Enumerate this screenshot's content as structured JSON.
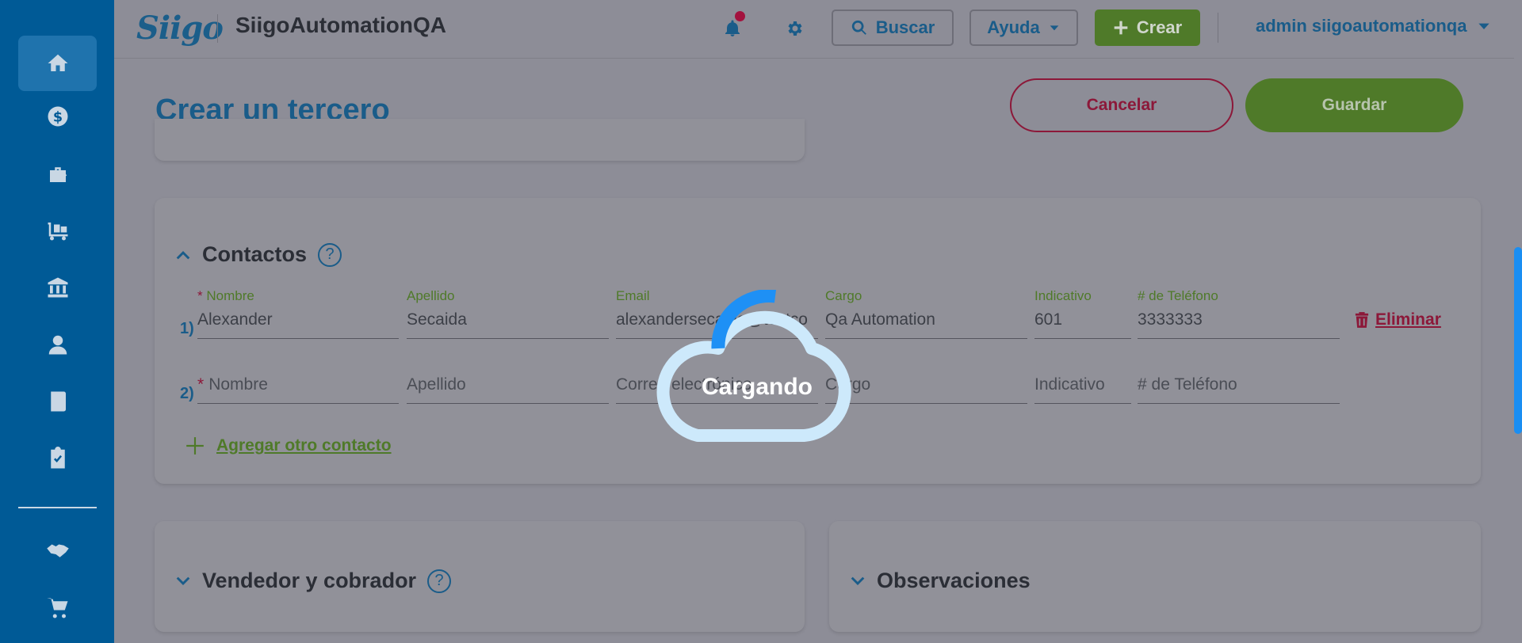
{
  "sidebar": {
    "items": [
      {
        "name": "home-icon",
        "active": true
      },
      {
        "name": "dollar-icon",
        "active": false
      },
      {
        "name": "shopping-bag-icon",
        "active": false
      },
      {
        "name": "cart-dolly-icon",
        "active": false
      },
      {
        "name": "bank-icon",
        "active": false
      },
      {
        "name": "employee-icon",
        "active": false
      },
      {
        "name": "book-icon",
        "active": false
      },
      {
        "name": "clipboard-check-icon",
        "active": false
      },
      {
        "name": "handshake-icon",
        "active": false
      },
      {
        "name": "shopping-cart-icon",
        "active": false
      }
    ]
  },
  "topbar": {
    "logo": "Siigo",
    "company": "SiigoAutomationQA",
    "search_label": "Buscar",
    "help_label": "Ayuda",
    "create_label": "Crear",
    "user_label": "admin siigoautomationqa"
  },
  "page": {
    "title": "Crear un tercero",
    "cancel_label": "Cancelar",
    "save_label": "Guardar"
  },
  "contacts": {
    "title": "Contactos",
    "help": "?",
    "labels": {
      "nombre": "Nombre",
      "apellido": "Apellido",
      "email": "Email",
      "cargo": "Cargo",
      "indicativo": "Indicativo",
      "telefono": "# de Teléfono"
    },
    "required_mark": "*",
    "rows": [
      {
        "num": "1)",
        "nombre": "Alexander",
        "apellido": "Secaida",
        "email": "alexandersecaida@testco",
        "cargo": "Qa Automation",
        "indicativo": "601",
        "telefono": "3333333"
      },
      {
        "num": "2)",
        "nombre": "Nombre",
        "apellido": "Apellido",
        "email": "Correo electrónico",
        "cargo": "Cargo",
        "indicativo": "Indicativo",
        "telefono": "# de Teléfono"
      }
    ],
    "delete_label": "Eliminar",
    "add_label": "Agregar otro contacto"
  },
  "sections": {
    "vendedor": "Vendedor y cobrador",
    "vendedor_help": "?",
    "observaciones": "Observaciones"
  },
  "loader": {
    "text": "Cargando"
  },
  "colors": {
    "sidebar": "#005a96",
    "accent_blue": "#1a5c89",
    "green": "#4f7a29",
    "red": "#8c1839",
    "loader_ring": "#1e90f5",
    "loader_cloud": "#cde9fb"
  }
}
